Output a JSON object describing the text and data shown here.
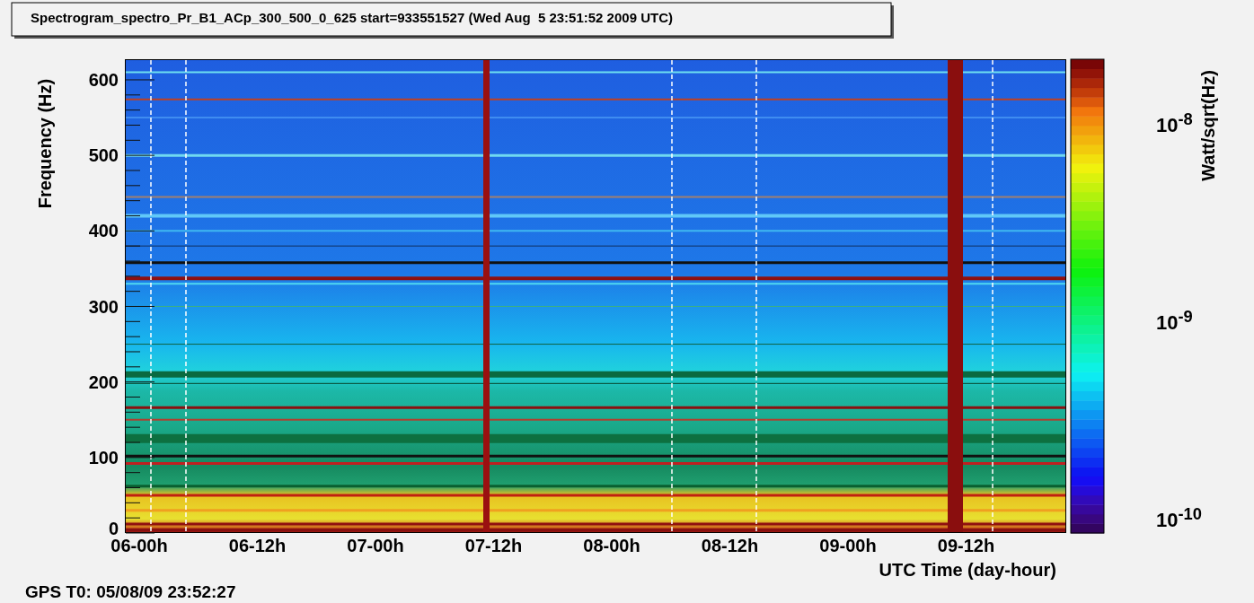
{
  "title": "Spectrogram_spectro_Pr_B1_ACp_300_500_0_625 start=933551527 (Wed Aug  5 23:51:52 2009 UTC)",
  "y_axis": {
    "label": "Frequency (Hz)",
    "ticks": [
      "600",
      "500",
      "400",
      "300",
      "200",
      "100",
      "0"
    ]
  },
  "x_axis": {
    "label": "UTC Time (day-hour)",
    "ticks": [
      "06-00h",
      "06-12h",
      "07-00h",
      "07-12h",
      "08-00h",
      "08-12h",
      "09-00h",
      "09-12h"
    ]
  },
  "color_scale": {
    "label": "Watt/sqrt(Hz)",
    "ticks": [
      "10$^{-8}$",
      "10$^{-9}$",
      "10$^{-10}$"
    ]
  },
  "footer": "GPS T0: 05/08/09 23:52:27"
}
